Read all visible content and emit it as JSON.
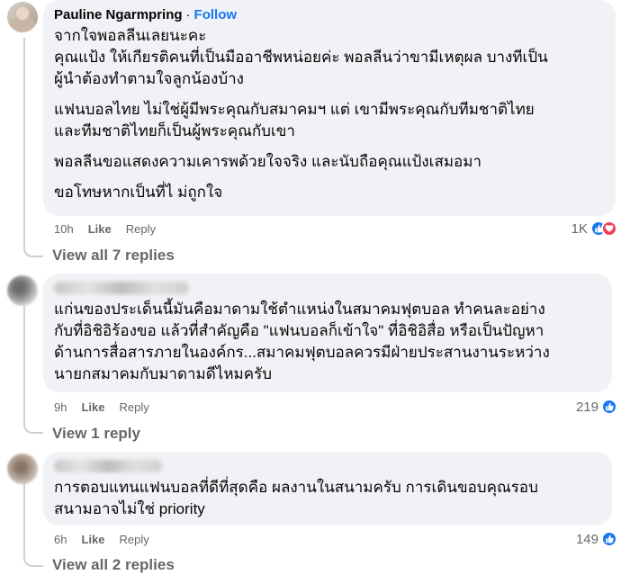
{
  "comments": [
    {
      "author": "Pauline Ngarmpring",
      "follow_label": "Follow",
      "separator": "·",
      "paragraphs": [
        "จากใจพอลลีนเลยนะคะ\nคุณแป้ง ให้เกียรติคนที่เป็นมืออาชีพหน่อยค่ะ พอลลีนว่าขามีเหตุผล บางทีเป็น\nผู้นำต้องทำตามใจลูกน้องบ้าง",
        "แฟนบอลไทย ไม่ใช่ผู้มีพระคุณกับสมาคมฯ แต่ เขามีพระคุณกับทีมชาติไทย\nและทีมชาติไทยก็เป็นผู้พระคุณกับเขา",
        "พอลลีนขอแสดงความเคารพด้วยใจจริง และนับถือคุณแป้งเสมอมา",
        "ขอโทษหากเป็นที่ไ ม่ถูกใจ"
      ],
      "time": "10h",
      "like_label": "Like",
      "reply_label": "Reply",
      "reaction_count": "1K",
      "reactions": [
        "like-icon",
        "love-icon"
      ],
      "view_replies": "View all 7 replies"
    },
    {
      "author": "",
      "paragraphs": [
        "แก่นของประเด็นนี้มันคือมาดามใช้ตำแหน่งในสมาคมฟุตบอล ทำคนละอย่าง\nกับที่อิชิอิร้องขอ แล้วที่สำคัญคือ \"แฟนบอลก็เข้าใจ\" ที่อิชิอิสื่อ หรือเป็นปัญหา\nด้านการสื่อสารภายในองค์กร...สมาคมฟุตบอลควรมีฝ่ายประสานงานระหว่าง\nนายกสมาคมกับมาดามดีไหมครับ"
      ],
      "time": "9h",
      "like_label": "Like",
      "reply_label": "Reply",
      "reaction_count": "219",
      "reactions": [
        "like-icon"
      ],
      "view_replies": "View 1 reply"
    },
    {
      "author": "",
      "paragraphs": [
        "การตอบแทนแฟนบอลที่ดีที่สุดคือ ผลงานในสนามครับ การเดินขอบคุณรอบ\nสนามอาจไม่ใช่ priority"
      ],
      "time": "6h",
      "like_label": "Like",
      "reply_label": "Reply",
      "reaction_count": "149",
      "reactions": [
        "like-icon"
      ],
      "view_replies": "View all 2 replies"
    }
  ],
  "colors": {
    "bubble": "#f0f2f5",
    "follow": "#1877f2",
    "meta": "#65676b",
    "like_reaction": "#1877f2",
    "love_reaction": "#f33e58"
  }
}
